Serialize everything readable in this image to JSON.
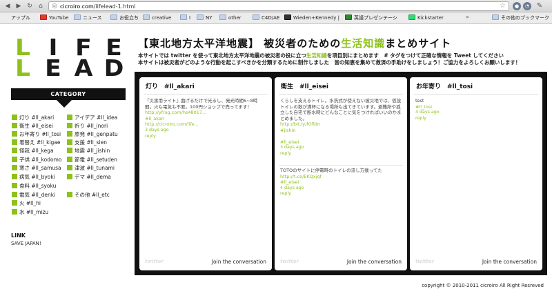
{
  "browser": {
    "url_host": "cicroiro.com",
    "url_path": "/lifelead-1.html",
    "bookmarks": [
      {
        "label": "アップル",
        "icon": "apple-icon"
      },
      {
        "label": "YouTube",
        "icon": "youtube-icon"
      },
      {
        "label": "ニュース",
        "icon": "folder-icon"
      },
      {
        "label": "お役立ち",
        "icon": "folder-icon"
      },
      {
        "label": "creative",
        "icon": "folder-icon"
      },
      {
        "label": "I",
        "icon": "folder-icon"
      },
      {
        "label": "NY",
        "icon": "folder-icon"
      },
      {
        "label": "other",
        "icon": "folder-icon"
      },
      {
        "label": "C4D/AE",
        "icon": "folder-icon"
      },
      {
        "label": "Wieden+Kennedy | F",
        "icon": "wk-icon"
      },
      {
        "label": "英語プレゼンテーシ",
        "icon": "tm-icon"
      },
      {
        "label": "Kickstarter",
        "icon": "kickstarter-icon"
      }
    ],
    "more_bookmarks": "その他のブックマーク"
  },
  "logo": {
    "row1": [
      "L",
      "I",
      "F",
      "E"
    ],
    "row2": [
      "L",
      "E",
      "A",
      "D"
    ]
  },
  "header": {
    "title_pre": "【東北地方太平洋地震】 被災者のための",
    "title_hl": "生活知識",
    "title_post": "まとめサイト",
    "intro1_pre": "本サイトでは twitter を使って東北地方太平洋地震の被災者の役に立つ",
    "intro1_hl": "生活知識",
    "intro1_post": "を項目別にまとめます　# タグをつけて正確な情報を Tweet してください",
    "intro2": "本サイトは被災者がどのような行動を起こすべきかを分類するために制作しました　皆の知恵を集めて救済の手助けをしましょう！ご協力をよろしくお願いします！"
  },
  "sidebar": {
    "category_heading": "CATEGORY",
    "left": [
      "灯り #ll_akari",
      "衛生 #ll_eisei",
      "お年寄り #ll_tosi",
      "着替え #ll_kigae",
      "怪我 #ll_kega",
      "子供 #ll_kodomo",
      "寒さ #ll_samusa",
      "病気 #ll_byoki",
      "食料 #ll_syoku",
      "電気 #ll_denki",
      "火 #ll_hi",
      "水 #ll_mizu"
    ],
    "right": [
      "アイデア #ll_idea",
      "祈り #ll_inori",
      "原発 #ll_genpatu",
      "支援 #ll_sien",
      "地震 #ll_jishin",
      "節電 #ll_setuden",
      "津波 #ll_tunami",
      "デマ #ll_dema"
    ],
    "other": "その他 #ll_etc",
    "link_heading": "LINK",
    "link_item": "SAVE JAPAN!"
  },
  "columns": [
    {
      "title": "灯り　#ll_akari",
      "tweets": [
        {
          "text": "『災害用ライト』曲げるだけで光るし、発光時間6~8時間。火も電気も不要。100円ショップで売ってます！",
          "links": [
            "http://yfrog.com/hs48017...",
            "#ll_akari",
            "http://cicroiro.com/life..."
          ],
          "time": "3 days ago",
          "reply": "reply"
        }
      ],
      "footer": "Join the conversation"
    },
    {
      "title": "衛生　#ll_eisei",
      "tweets": [
        {
          "text": "くらしを支えるトイレ。水洗式が使えない被災地では、仮設トイレの数が満杯になる場所も出てきています。避難所や孤立した自宅で断水時にどんなことに気をつければいいのかまとめました。",
          "links": [
            "http://bit.ly/fOfldn",
            "#jishin",
            "",
            "#ll_eisei"
          ],
          "time": "3 days ago",
          "reply": "reply"
        },
        {
          "text": "TOTOのサイトに停電時のトイレの流し方載ってた",
          "links": [
            "http://t.co/EKQxjqf",
            "#ll_eisei"
          ],
          "time": "4 days ago",
          "reply": "reply"
        }
      ],
      "footer": "Join the conversation"
    },
    {
      "title": "お年寄り　#ll_tosi",
      "tweets": [
        {
          "text": "test",
          "links": [
            "#ll_tosi"
          ],
          "time": "4 days ago",
          "reply": "reply"
        }
      ],
      "footer": "Join the conversation"
    }
  ],
  "footer": {
    "copyright": "copyright © 2010-2011 cicroiro All Right Resreved"
  },
  "colors": {
    "accent": "#8dc11c",
    "board": "#111111"
  }
}
